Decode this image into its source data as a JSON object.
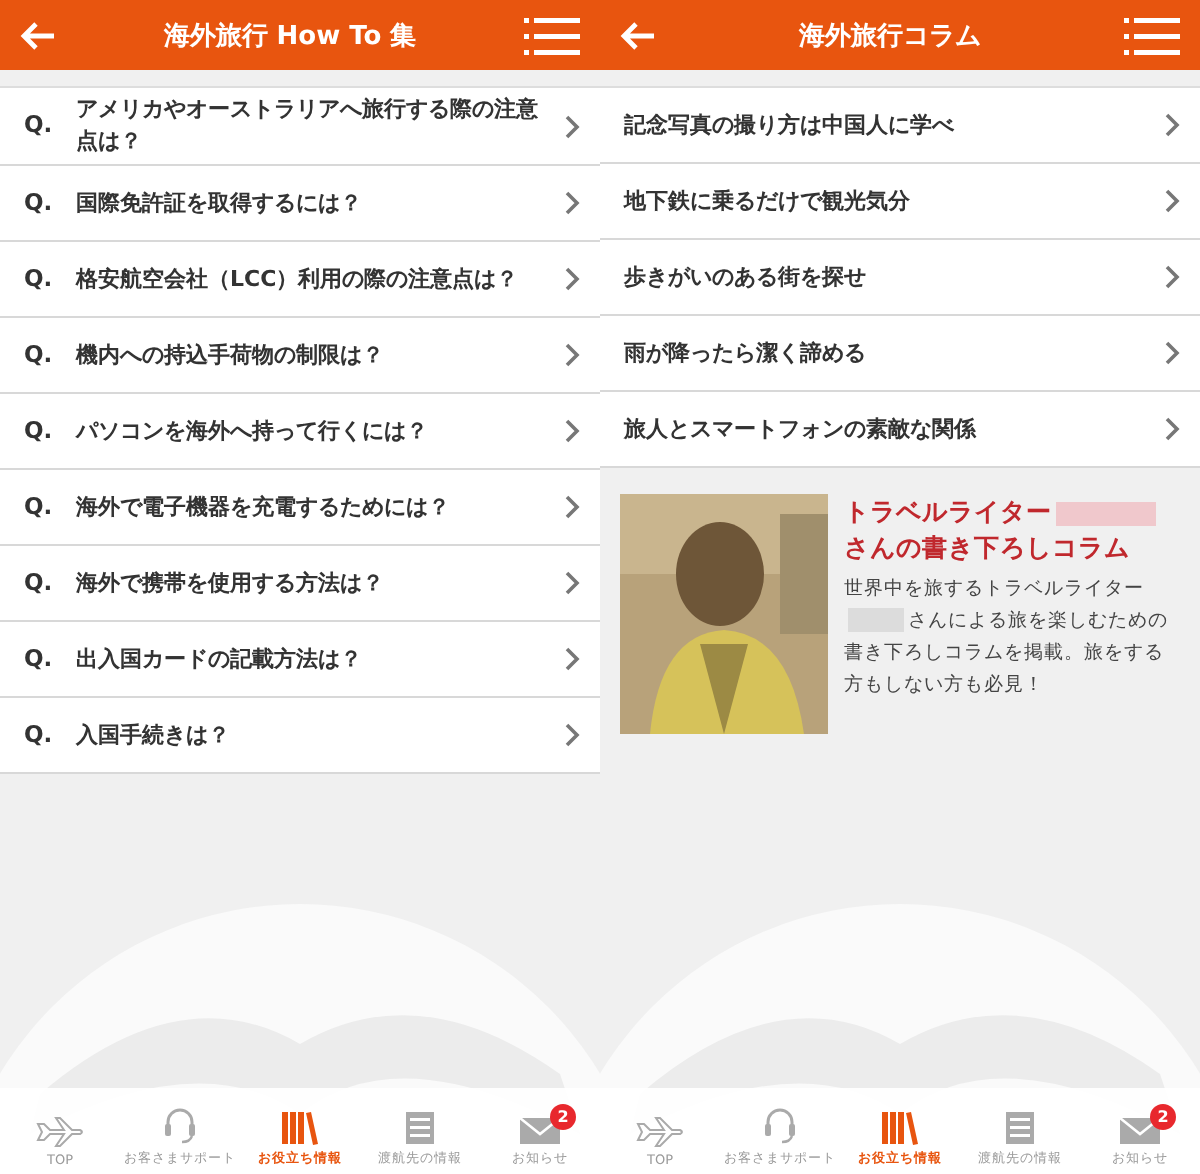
{
  "screens": [
    {
      "header": {
        "title": "海外旅行 How To 集"
      },
      "list": [
        {
          "prefix": "Q.",
          "text": "アメリカやオーストラリアへ旅行する際の注意点は？"
        },
        {
          "prefix": "Q.",
          "text": "国際免許証を取得するには？"
        },
        {
          "prefix": "Q.",
          "text": "格安航空会社（LCC）利用の際の注意点は？"
        },
        {
          "prefix": "Q.",
          "text": "機内への持込手荷物の制限は？"
        },
        {
          "prefix": "Q.",
          "text": "パソコンを海外へ持って行くには？"
        },
        {
          "prefix": "Q.",
          "text": "海外で電子機器を充電するためには？"
        },
        {
          "prefix": "Q.",
          "text": "海外で携帯を使用する方法は？"
        },
        {
          "prefix": "Q.",
          "text": "出入国カードの記載方法は？"
        },
        {
          "prefix": "Q.",
          "text": "入国手続きは？"
        }
      ],
      "tabbar": [
        {
          "kind": "plane",
          "label": "TOP",
          "selected": false
        },
        {
          "kind": "headset",
          "label": "お客さまサポート",
          "selected": false
        },
        {
          "kind": "books",
          "label": "お役立ち情報",
          "selected": true
        },
        {
          "kind": "paper",
          "label": "渡航先の情報",
          "selected": false
        },
        {
          "kind": "mail",
          "label": "お知らせ",
          "selected": false,
          "badge": "2"
        }
      ]
    },
    {
      "header": {
        "title": "海外旅行コラム"
      },
      "list": [
        {
          "text": "記念写真の撮り方は中国人に学べ"
        },
        {
          "text": "地下鉄に乗るだけで観光気分"
        },
        {
          "text": "歩きがいのある街を探せ"
        },
        {
          "text": "雨が降ったら潔く諦める"
        },
        {
          "text": "旅人とスマートフォンの素敵な関係"
        }
      ],
      "feature": {
        "title_before": "トラベルライター",
        "title_after": "さんの書き下ろしコラム",
        "body_before": "世界中を旅するトラベルライター",
        "body_after": "さんによる旅を楽しむための書き下ろしコラムを掲載。旅をする方もしない方も必見！"
      },
      "tabbar": [
        {
          "kind": "plane",
          "label": "TOP",
          "selected": false
        },
        {
          "kind": "headset",
          "label": "お客さまサポート",
          "selected": false
        },
        {
          "kind": "books",
          "label": "お役立ち情報",
          "selected": true
        },
        {
          "kind": "paper",
          "label": "渡航先の情報",
          "selected": false
        },
        {
          "kind": "mail",
          "label": "お知らせ",
          "selected": false,
          "badge": "2"
        }
      ]
    }
  ]
}
